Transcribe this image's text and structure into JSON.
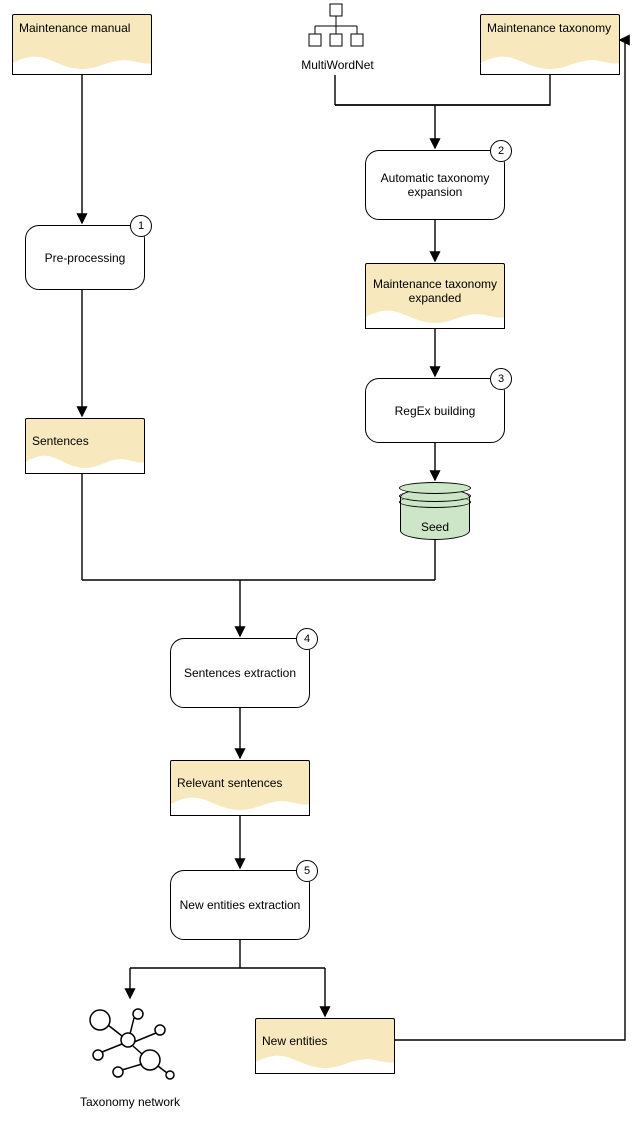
{
  "nodes": {
    "maintenance_manual": "Maintenance manual",
    "maintenance_taxonomy": "Maintenance taxonomy",
    "multiwordnet": "MultiWordNet",
    "pre_processing": "Pre-processing",
    "auto_taxonomy_expansion": "Automatic taxonomy expansion",
    "maintenance_taxonomy_expanded": "Maintenance taxonomy expanded",
    "regex_building": "RegEx building",
    "seed": "Seed",
    "sentences": "Sentences",
    "sentences_extraction": "Sentences extraction",
    "relevant_sentences": "Relevant sentences",
    "new_entities_extraction": "New entities extraction",
    "new_entities": "New entities",
    "taxonomy_network": "Taxonomy network"
  },
  "badges": {
    "pre_processing": "1",
    "auto_taxonomy_expansion": "2",
    "regex_building": "3",
    "sentences_extraction": "4",
    "new_entities_extraction": "5"
  },
  "chart_data": {
    "type": "diagram",
    "title": "",
    "flow_description": "Process flowchart for maintenance taxonomy expansion and entity extraction",
    "nodes": [
      {
        "id": "maintenance_manual",
        "type": "document",
        "label": "Maintenance manual"
      },
      {
        "id": "multiwordnet",
        "type": "external-resource",
        "label": "MultiWordNet"
      },
      {
        "id": "maintenance_taxonomy",
        "type": "document",
        "label": "Maintenance taxonomy"
      },
      {
        "id": "pre_processing",
        "type": "process",
        "label": "Pre-processing",
        "step": 1
      },
      {
        "id": "auto_taxonomy_expansion",
        "type": "process",
        "label": "Automatic taxonomy expansion",
        "step": 2
      },
      {
        "id": "maintenance_taxonomy_expanded",
        "type": "document",
        "label": "Maintenance taxonomy expanded"
      },
      {
        "id": "regex_building",
        "type": "process",
        "label": "RegEx building",
        "step": 3
      },
      {
        "id": "seed",
        "type": "datastore",
        "label": "Seed"
      },
      {
        "id": "sentences",
        "type": "document",
        "label": "Sentences"
      },
      {
        "id": "sentences_extraction",
        "type": "process",
        "label": "Sentences extraction",
        "step": 4
      },
      {
        "id": "relevant_sentences",
        "type": "document",
        "label": "Relevant sentences"
      },
      {
        "id": "new_entities_extraction",
        "type": "process",
        "label": "New entities extraction",
        "step": 5
      },
      {
        "id": "taxonomy_network",
        "type": "output-graph",
        "label": "Taxonomy network"
      },
      {
        "id": "new_entities",
        "type": "document",
        "label": "New entities"
      }
    ],
    "edges": [
      {
        "from": "maintenance_manual",
        "to": "pre_processing"
      },
      {
        "from": "multiwordnet",
        "to": "auto_taxonomy_expansion"
      },
      {
        "from": "maintenance_taxonomy",
        "to": "auto_taxonomy_expansion"
      },
      {
        "from": "pre_processing",
        "to": "sentences"
      },
      {
        "from": "auto_taxonomy_expansion",
        "to": "maintenance_taxonomy_expanded"
      },
      {
        "from": "maintenance_taxonomy_expanded",
        "to": "regex_building"
      },
      {
        "from": "regex_building",
        "to": "seed"
      },
      {
        "from": "sentences",
        "to": "sentences_extraction"
      },
      {
        "from": "seed",
        "to": "sentences_extraction"
      },
      {
        "from": "sentences_extraction",
        "to": "relevant_sentences"
      },
      {
        "from": "relevant_sentences",
        "to": "new_entities_extraction"
      },
      {
        "from": "new_entities_extraction",
        "to": "taxonomy_network"
      },
      {
        "from": "new_entities_extraction",
        "to": "new_entities"
      },
      {
        "from": "new_entities",
        "to": "maintenance_taxonomy",
        "note": "feedback-loop"
      }
    ]
  }
}
